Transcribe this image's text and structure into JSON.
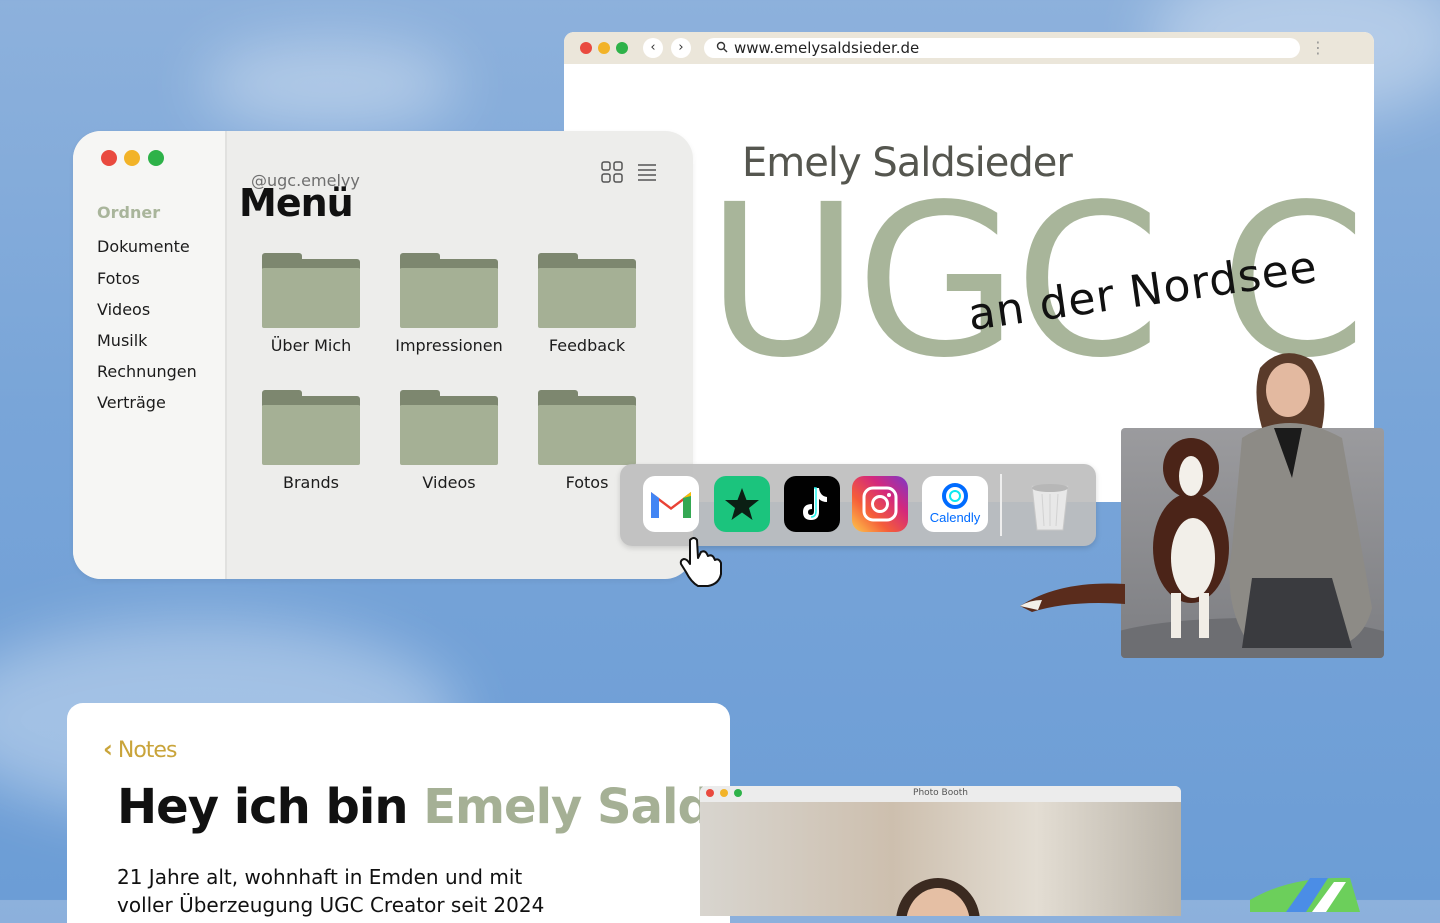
{
  "browser": {
    "url": "www.emelysaldsieder.de",
    "site_name": "Emely Saldsieder",
    "hero_text": "UGC CR",
    "tagline": "an der Nordsee",
    "back_glyph": "‹",
    "forward_glyph": "›",
    "more_glyph": "⋮"
  },
  "finder": {
    "handle": "@ugc.emelyy",
    "title": "Menü",
    "sidebar_heading": "Ordner",
    "sidebar_items": [
      "Dokumente",
      "Fotos",
      "Videos",
      "Musilk",
      "Rechnungen",
      "Verträge"
    ],
    "folders": [
      "Über Mich",
      "Impressionen",
      "Feedback",
      "Brands",
      "Videos",
      "Fotos"
    ]
  },
  "dock": {
    "apps": [
      "gmail-icon",
      "star-app-icon",
      "tiktok-icon",
      "instagram-icon",
      "calendly-icon",
      "trash-icon"
    ],
    "calendly_label": "Calendly"
  },
  "notes": {
    "back_label": "Notes",
    "title_plain": "Hey ich bin ",
    "title_accent": "Emely Saldsieder",
    "body_line1": "21 Jahre alt, wohnhaft in Emden und mit",
    "body_line2": "voller Überzeugung UGC Creator seit 2024"
  },
  "photo_booth": {
    "title": "Photo Booth"
  },
  "colors": {
    "accent_sage": "#a5b095",
    "notes_gold": "#c9a43a",
    "sky": "#7fa8da"
  }
}
